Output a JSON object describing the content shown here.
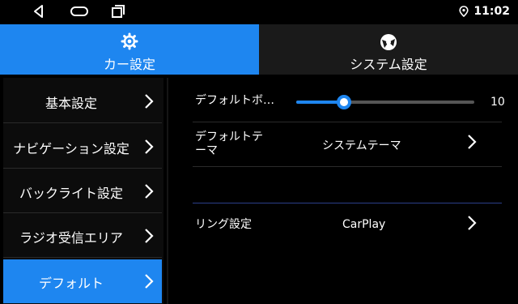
{
  "status": {
    "time": "11:02",
    "icons": [
      "back-icon",
      "home-icon",
      "recents-icon",
      "location-icon"
    ]
  },
  "tabs": [
    {
      "label": "カー設定",
      "icon": "gear-icon",
      "active": true
    },
    {
      "label": "システム設定",
      "icon": "system-settings-icon",
      "active": false
    }
  ],
  "sidebar": {
    "items": [
      {
        "label": "基本設定"
      },
      {
        "label": "ナビゲーション設定"
      },
      {
        "label": "バックライト設定"
      },
      {
        "label": "ラジオ受信エリア"
      },
      {
        "label": "デフォルト",
        "active": true
      }
    ]
  },
  "content": {
    "volume": {
      "label": "デフォルトボ…",
      "value": "10",
      "level_fraction": 0.27
    },
    "theme": {
      "label_line1": "デフォルトテ",
      "label_line2": "ーマ",
      "value": "システムテーマ"
    },
    "ring": {
      "label": "リング設定",
      "value": "CarPlay"
    }
  },
  "colors": {
    "accent": "#1e86f0",
    "background": "#000000",
    "tab_inactive": "#1a1a1a"
  }
}
